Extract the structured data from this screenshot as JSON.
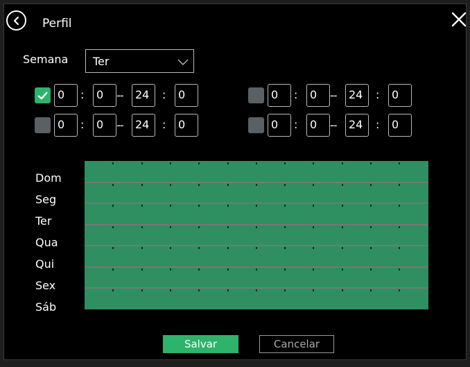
{
  "dialog": {
    "title": "Perfil"
  },
  "week": {
    "label": "Semana",
    "value": "Ter"
  },
  "periods": [
    {
      "enabled": true,
      "start_h": "0",
      "start_m": "0",
      "end_h": "24",
      "end_m": "0"
    },
    {
      "enabled": false,
      "start_h": "0",
      "start_m": "0",
      "end_h": "24",
      "end_m": "0"
    },
    {
      "enabled": false,
      "start_h": "0",
      "start_m": "0",
      "end_h": "24",
      "end_m": "0"
    },
    {
      "enabled": false,
      "start_h": "0",
      "start_m": "0",
      "end_h": "24",
      "end_m": "0"
    }
  ],
  "separators": {
    "colon": ":",
    "dash": "--"
  },
  "schedule": {
    "days": [
      "Dom",
      "Seg",
      "Ter",
      "Qua",
      "Qui",
      "Sex",
      "Sáb"
    ],
    "fill_color": "#2f8f60"
  },
  "buttons": {
    "save": "Salvar",
    "cancel": "Cancelar"
  },
  "colors": {
    "accent": "#2db36a",
    "background": "#000000"
  }
}
